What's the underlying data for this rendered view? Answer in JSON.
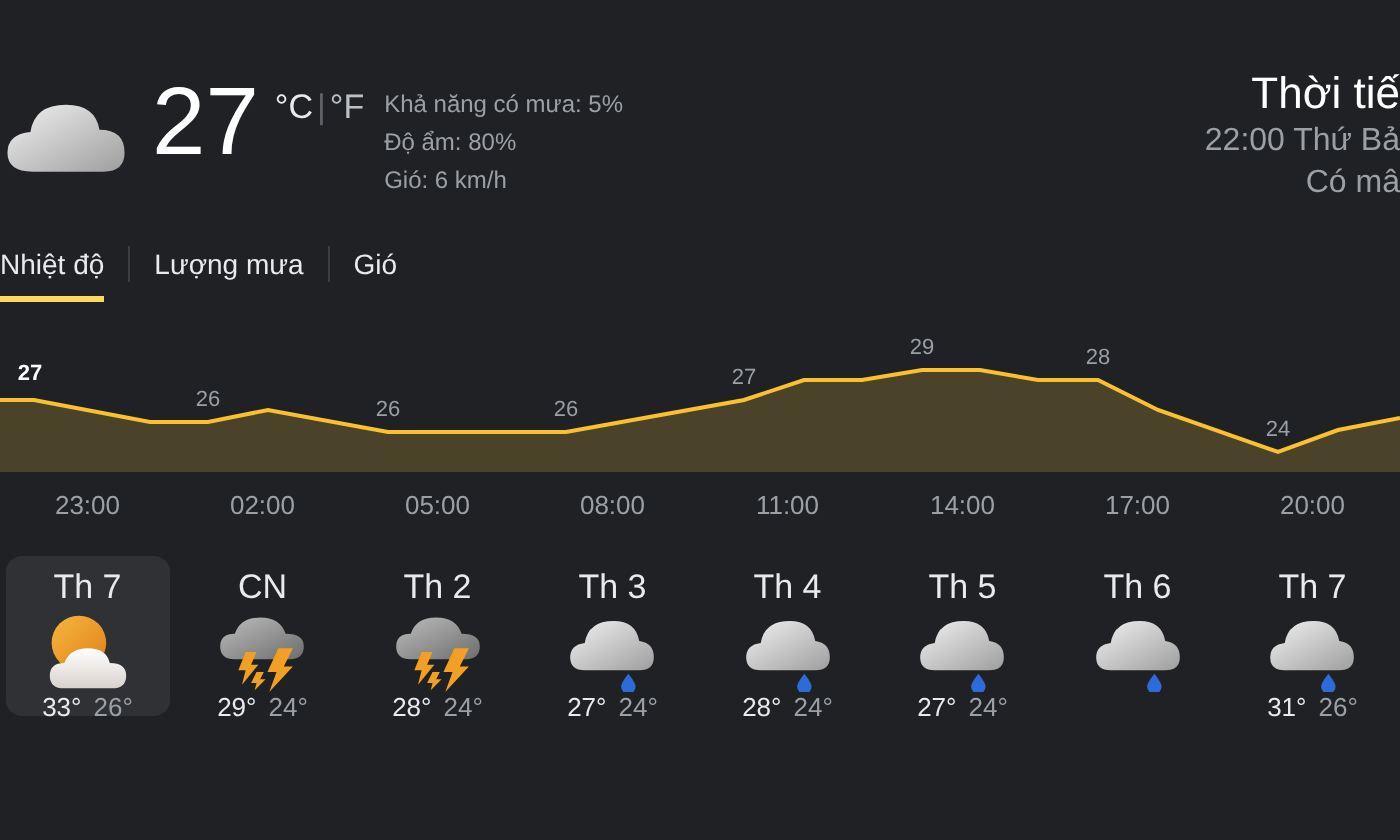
{
  "current": {
    "kind": "cloud",
    "temperature": "27",
    "unit_c": "°C",
    "unit_separator": "|",
    "unit_f": "°F",
    "details": [
      "Khả năng có mưa: 5%",
      "Độ ẩm: 80%",
      "Gió: 6 km/h"
    ]
  },
  "header": {
    "title": "Thời tiế",
    "datetime": "22:00 Thứ Bả",
    "condition": "Có mâ"
  },
  "tabs": [
    {
      "label": "Nhiệt độ",
      "selected": true
    },
    {
      "label": "Lượng mưa",
      "selected": false
    },
    {
      "label": "Gió",
      "selected": false
    }
  ],
  "chart": {
    "temp_labels": [
      {
        "text": "27",
        "selected": true
      },
      {
        "text": "26",
        "selected": false
      },
      {
        "text": "26",
        "selected": false
      },
      {
        "text": "26",
        "selected": false
      },
      {
        "text": "27",
        "selected": false
      },
      {
        "text": "29",
        "selected": false
      },
      {
        "text": "28",
        "selected": false
      },
      {
        "text": "24",
        "selected": false
      }
    ],
    "hours": [
      "23:00",
      "02:00",
      "05:00",
      "08:00",
      "11:00",
      "14:00",
      "17:00",
      "20:00"
    ]
  },
  "days": [
    {
      "name": "Th 7",
      "kind": "partly-cloudy",
      "high": "33°",
      "low": "26°",
      "selected": true
    },
    {
      "name": "CN",
      "kind": "thunderstorm",
      "high": "29°",
      "low": "24°",
      "selected": false
    },
    {
      "name": "Th 2",
      "kind": "thunderstorm",
      "high": "28°",
      "low": "24°",
      "selected": false
    },
    {
      "name": "Th 3",
      "kind": "rain",
      "high": "27°",
      "low": "24°",
      "selected": false
    },
    {
      "name": "Th 4",
      "kind": "rain",
      "high": "28°",
      "low": "24°",
      "selected": false
    },
    {
      "name": "Th 5",
      "kind": "rain",
      "high": "27°",
      "low": "24°",
      "selected": false
    },
    {
      "name": "Th 6",
      "kind": "rain",
      "selected": false
    },
    {
      "name": "Th 7",
      "kind": "rain",
      "high": "31°",
      "low": "26°",
      "selected": false
    }
  ]
}
